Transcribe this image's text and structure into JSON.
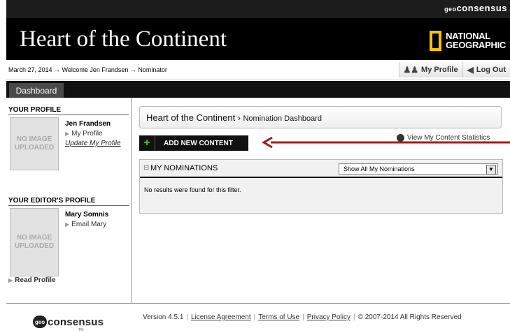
{
  "top_strip": {
    "brand_prefix": "geo",
    "brand_name": "consensus"
  },
  "header": {
    "title": "Heart of the Continent",
    "ng_line1": "NATIONAL",
    "ng_line2": "GEOGRAPHIC"
  },
  "info_bar": {
    "breadcrumb": "March 27, 2014 → Welcome Jen Frandsen → Nominator",
    "my_profile": "My Profile",
    "log_out": "Log Out"
  },
  "tabs": {
    "dashboard": "Dashboard"
  },
  "sidebar": {
    "your_profile_title": "YOUR PROFILE",
    "no_image_1": "NO IMAGE",
    "no_image_2": "UPLOADED",
    "user_name": "Jen Frandsen",
    "my_profile_link": "My Profile",
    "update_profile_link": "Update My Profile",
    "editor_title": "YOUR EDITOR'S PROFILE",
    "editor_name": "Mary Somnis",
    "email_link": "Email Mary",
    "read_profile": "Read Profile"
  },
  "main": {
    "crumb_site": "Heart of the Continent",
    "crumb_sep": "›",
    "crumb_page": "Nomination Dashboard",
    "add_button": "ADD NEW CONTENT",
    "stats_link": "View My Content Statistics",
    "nominations_title": "MY NOMINATIONS",
    "filter_value": "Show All My Nominations",
    "no_results": "No results were found for this filter."
  },
  "footer": {
    "logo_prefix": "geo",
    "logo_word": "consensus",
    "logo_tm": "TM",
    "version": "Version 4.5.1",
    "license": "License Agreement",
    "terms": "Terms of Use",
    "privacy": "Privacy Policy",
    "copyright": "© 2007-2014 All Rights Reserved"
  },
  "colors": {
    "header_bg": "#000000",
    "accent_yellow": "#f7c400",
    "arrow_red": "#a31b1b",
    "plus_green": "#5cbf2a"
  }
}
